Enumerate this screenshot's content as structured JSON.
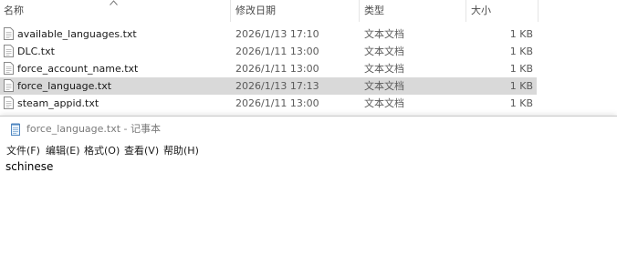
{
  "explorer": {
    "columns": {
      "name": "名称",
      "date": "修改日期",
      "type": "类型",
      "size": "大小"
    },
    "files": [
      {
        "name": "available_languages.txt",
        "date": "2026/1/13 17:10",
        "type": "文本文档",
        "size": "1 KB"
      },
      {
        "name": "DLC.txt",
        "date": "2026/1/11 13:00",
        "type": "文本文档",
        "size": "1 KB"
      },
      {
        "name": "force_account_name.txt",
        "date": "2026/1/11 13:00",
        "type": "文本文档",
        "size": "1 KB"
      },
      {
        "name": "force_language.txt",
        "date": "2026/1/13 17:13",
        "type": "文本文档",
        "size": "1 KB",
        "selected": true
      },
      {
        "name": "steam_appid.txt",
        "date": "2026/1/11 13:00",
        "type": "文本文档",
        "size": "1 KB"
      }
    ]
  },
  "notepad": {
    "title": "force_language.txt - 记事本",
    "menu": [
      "文件(F)",
      "编辑(E)",
      "格式(O)",
      "查看(V)",
      "帮助(H)"
    ],
    "content": "schinese"
  },
  "colors": {
    "selected_row": "#d9d9d9",
    "header_text": "#4a4a4a"
  }
}
